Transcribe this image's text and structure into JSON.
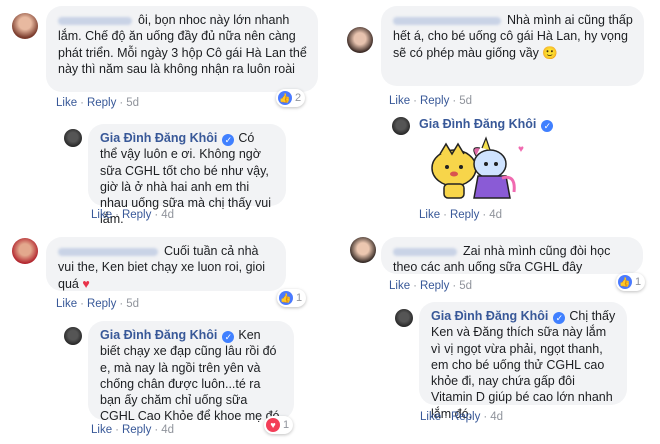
{
  "colors": {
    "link": "#385898",
    "bubble": "#f2f3f5",
    "like": "#4a7aff",
    "love": "#f33e58",
    "meta": "#90949c"
  },
  "actions": {
    "like": "Like",
    "reply": "Reply",
    "sep": "·"
  },
  "threads": [
    {
      "comment": {
        "text": "ôi, bọn nhoc này lớn nhanh lắm. Chế độ ăn uống đầy đủ nữa nên càng phát triển. Mỗi ngày 3 hộp Cô gái Hà Lan thể này thì năm sau là không nhận ra luôn roài",
        "age": "5d",
        "reaction_icon": "like-icon",
        "reaction_count": "2"
      },
      "reply": {
        "author": "Gia Đình Đăng Khôi",
        "verified_icon": "verified-badge-icon",
        "text": "Có thể vậy luôn e ơi. Không ngờ sữa CGHL tốt cho bé như vậy, giờ là ở nhà hai anh em thi nhau uống sữa mà chị thấy vui lắm.",
        "age": "4d"
      }
    },
    {
      "comment": {
        "text": "Nhà mình ai cũng thấp hết á, cho bé uống cô gái Hà Lan, hy vọng sẽ có phép màu giống vầy",
        "emoji": "🙂",
        "age": "5d"
      },
      "reply": {
        "author": "Gia Đình Đăng Khôi",
        "verified_icon": "verified-badge-icon",
        "sticker": "bt21-sticker",
        "age": "4d"
      }
    },
    {
      "comment": {
        "text": "Cuối tuần cả nhà vui the, Ken biet chạy xe luon roi, gioi quá",
        "emoji": "♥",
        "age": "5d",
        "reaction_icon": "like-icon",
        "reaction_count": "1"
      },
      "reply": {
        "author": "Gia Đình Đăng Khôi",
        "verified_icon": "verified-badge-icon",
        "text": "Ken biết chạy xe đạp cũng lâu rồi đó e, mà nay là ngồi trên yên và chống chân được luôn...té ra bạn ấy chăm chỉ uống sữa CGHL Cao Khỏe để khoe mẹ đó",
        "age": "4d",
        "reaction_icon": "love-icon",
        "reaction_count": "1"
      }
    },
    {
      "comment": {
        "text": "Zai nhà mình cũng đòi học theo các anh uống sữa CGHL đây",
        "age": "5d",
        "reaction_icon": "like-icon",
        "reaction_count": "1"
      },
      "reply": {
        "author": "Gia Đình Đăng Khôi",
        "verified_icon": "verified-badge-icon",
        "text": "Chị thấy Ken và Đăng thích sữa này lắm vì vị ngọt vừa phải, ngọt thanh, em cho bé uống thử CGHL cao khỏe đi, nay chứa gấp đôi Vitamin D giúp bé cao lớn nhanh lắm đó.",
        "age": "4d"
      }
    }
  ]
}
